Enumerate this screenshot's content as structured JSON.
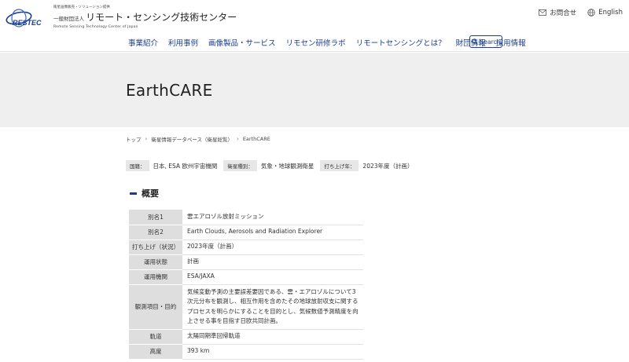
{
  "brand": {
    "logo_text": "RESTEC",
    "tagline": "衛星画像販売・ソリューション提供",
    "org_prefix": "一般財団法人",
    "org_name": "リモート・センシング技術センター",
    "english_name": "Remote Sensing Technology Center of Japan",
    "accent_color": "#1a3d8f"
  },
  "top_links": {
    "contact": "お問合せ",
    "english": "English"
  },
  "nav": {
    "items": [
      "事業紹介",
      "利用事例",
      "画像製品・サービス",
      "リモセン研修ラボ",
      "リモートセンシングとは？",
      "財団情報",
      "採用情報"
    ],
    "search_label": "Search"
  },
  "hero": {
    "title": "EarthCARE"
  },
  "breadcrumb": [
    "トップ",
    "衛星情報データベース（衛星総覧）",
    "EarthCARE"
  ],
  "meta": {
    "country_label": "国籍：",
    "country_value": "日本, ESA 欧州宇宙機関",
    "type_label": "衛星種別：",
    "type_value": "気象・地球観測衛星",
    "launch_label": "打ち上げ年：",
    "launch_value": "2023年度（計画）"
  },
  "overview": {
    "heading": "概要",
    "rows": [
      {
        "label": "別名1",
        "value": "雲エアロゾル放射ミッション"
      },
      {
        "label": "別名2",
        "value": "Earth Clouds, Aerosols and Radiation Explorer"
      },
      {
        "label": "打ち上げ（状況）",
        "value": "2023年度（計画）"
      },
      {
        "label": "運用状態",
        "value": "計画"
      },
      {
        "label": "運用機関",
        "value": "ESA/JAXA"
      },
      {
        "label": "観測項目・目的",
        "value": "気候変動予測の主要誤差要因である、雲・エアロゾルについて3次元分布を観測し、相互作用を含めたその地球放射収支に関するプロセスを明らかにすることを目的とし、気候数値予測精度を向上させる事を目指す日欧共同計画。"
      },
      {
        "label": "軌道",
        "value": "太陽同期準回帰軌道"
      },
      {
        "label": "高度",
        "value": "393 km"
      }
    ]
  }
}
